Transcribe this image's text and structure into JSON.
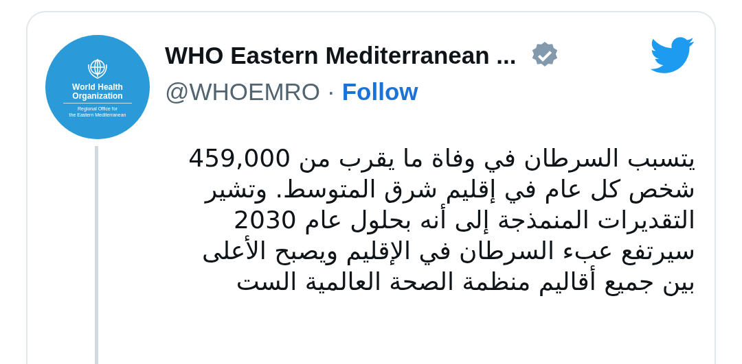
{
  "avatar": {
    "logo_lines": [
      "World Health",
      "Organization"
    ],
    "logo_sublines": [
      "Regional Office for",
      "the Eastern Mediterranean"
    ]
  },
  "author": {
    "name": "WHO Eastern Mediterranean ...",
    "verified": true,
    "handle": "@WHOEMRO",
    "separator": "·",
    "follow": "Follow"
  },
  "tweet": {
    "lines": [
      "يتسبب السرطان في وفاة ما يقرب من 459,000",
      "شخص كل عام في إقليم شرق المتوسط. وتشير",
      "التقديرات المنمذجة إلى أنه بحلول عام 2030",
      "سيرتفع عبء السرطان في الإقليم ويصبح الأعلى",
      "بين جميع أقاليم منظمة الصحة العالمية الست"
    ]
  }
}
